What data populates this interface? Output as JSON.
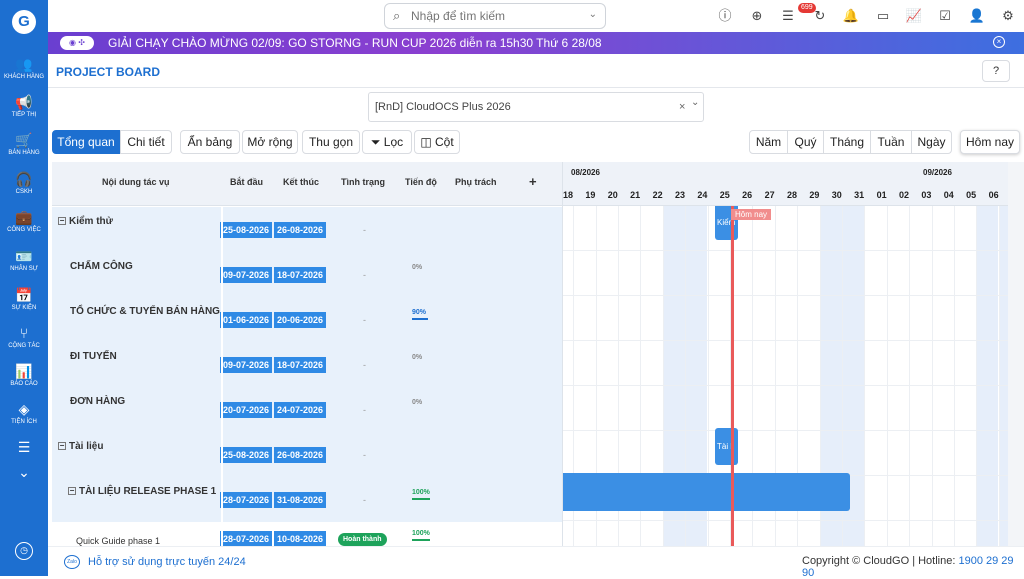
{
  "sidebar": {
    "items": [
      {
        "icon": "users-icon",
        "glyph": "👥",
        "label": "KHÁCH HÀNG"
      },
      {
        "icon": "megaphone-icon",
        "glyph": "📢",
        "label": "TIẾP THỊ"
      },
      {
        "icon": "cart-icon",
        "glyph": "🛒",
        "label": "BÁN HÀNG"
      },
      {
        "icon": "headset-icon",
        "glyph": "🎧",
        "label": "CSKH"
      },
      {
        "icon": "briefcase-icon",
        "glyph": "💼",
        "label": "CÔNG VIỆC"
      },
      {
        "icon": "id-card-icon",
        "glyph": "🪪",
        "label": "NHÂN SỰ"
      },
      {
        "icon": "calendar-icon",
        "glyph": "📅",
        "label": "SỰ KIỆN"
      },
      {
        "icon": "workflow-icon",
        "glyph": "⑂",
        "label": "CỘNG TÁC"
      },
      {
        "icon": "report-icon",
        "glyph": "📊",
        "label": "BÁO CÁO"
      },
      {
        "icon": "layers-icon",
        "glyph": "◈",
        "label": "TIỆN ÍCH"
      },
      {
        "icon": "list-icon",
        "glyph": "☰",
        "label": ""
      },
      {
        "icon": "chevron-down-icon",
        "glyph": "⌄",
        "label": ""
      }
    ]
  },
  "search": {
    "placeholder": "Nhập để tìm kiếm"
  },
  "notifications": {
    "count": "699"
  },
  "banner": {
    "text": "GIẢI CHẠY CHÀO MỪNG 02/09: GO STORNG - RUN CUP 2026 diễn ra 15h30 Thứ 6 28/08"
  },
  "page": {
    "title": "PROJECT BOARD"
  },
  "project": {
    "selected": "[RnD] CloudOCS Plus 2026"
  },
  "toolbar": {
    "overview": "Tổng quan",
    "detail": "Chi tiết",
    "hide_table": "Ẩn bảng",
    "expand": "Mở rộng",
    "collapse": "Thu gọn",
    "filter": "Lọc",
    "columns": "Cột"
  },
  "range": {
    "year": "Năm",
    "quarter": "Quý",
    "month": "Tháng",
    "week": "Tuần",
    "day": "Ngày",
    "today": "Hôm nay"
  },
  "grid": {
    "headers": {
      "task": "Nội dung tác vụ",
      "start": "Bắt đầu",
      "end": "Kết thúc",
      "status": "Tình trạng",
      "progress": "Tiến độ",
      "owner": "Phụ trách",
      "add": "+"
    },
    "rows": [
      {
        "name": "Kiểm thử",
        "group": true,
        "start": "25-08-2026",
        "end": "26-08-2026",
        "status": "-",
        "progress": ""
      },
      {
        "name": "CHẤM CÔNG",
        "group": false,
        "start": "09-07-2026",
        "end": "18-07-2026",
        "status": "-",
        "progress": "0%"
      },
      {
        "name": "TỔ CHỨC & TUYỂN BÁN HÀNG",
        "group": false,
        "start": "01-06-2026",
        "end": "20-06-2026",
        "status": "-",
        "progress": "90%"
      },
      {
        "name": "ĐI TUYẾN",
        "group": false,
        "start": "09-07-2026",
        "end": "18-07-2026",
        "status": "-",
        "progress": "0%"
      },
      {
        "name": "ĐƠN HÀNG",
        "group": false,
        "start": "20-07-2026",
        "end": "24-07-2026",
        "status": "-",
        "progress": "0%"
      },
      {
        "name": "Tài liệu",
        "group": true,
        "start": "25-08-2026",
        "end": "26-08-2026",
        "status": "-",
        "progress": ""
      },
      {
        "name": "TÀI LIỆU RELEASE PHASE 1",
        "group": true,
        "start": "28-07-2026",
        "end": "31-08-2026",
        "status": "-",
        "progress": "100%"
      },
      {
        "name": "Quick Guide phase 1",
        "group": false,
        "start": "28-07-2026",
        "end": "10-08-2026",
        "status": "Hoàn thành",
        "progress": "100%"
      }
    ]
  },
  "gantt": {
    "months": [
      "08/2026",
      "09/2026"
    ],
    "days": [
      "18",
      "19",
      "20",
      "21",
      "22",
      "23",
      "24",
      "25",
      "26",
      "27",
      "28",
      "29",
      "30",
      "31",
      "01",
      "02",
      "03",
      "04",
      "05",
      "06"
    ],
    "weekend_days": [
      "22",
      "23",
      "29",
      "30",
      "05",
      "06"
    ],
    "today_label": "Hôm nay",
    "bars": [
      {
        "label": "Kiểm",
        "start": "25-08-2026",
        "end": "26-08-2026"
      },
      {
        "label": "Tài l",
        "start": "25-08-2026",
        "end": "26-08-2026"
      },
      {
        "label": "",
        "start": "28-07-2026",
        "end": "31-08-2026"
      }
    ]
  },
  "footer": {
    "support": "Hỗ trợ sử dụng trực tuyến 24/24",
    "copyright": "Copyright © CloudGO | Hotline: ",
    "hotline": "1900 29 29 90",
    "zalo": "Zalo"
  },
  "colors": {
    "brand": "#1d6fd0",
    "bar": "#3b8fe4",
    "today": "#e95a5a",
    "done": "#1ea35b"
  }
}
